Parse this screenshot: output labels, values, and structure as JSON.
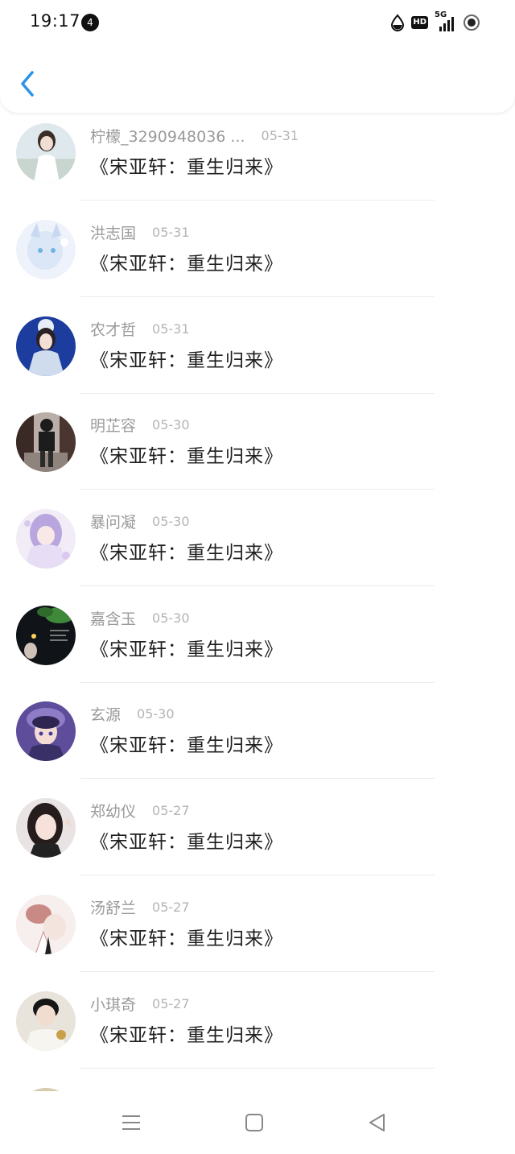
{
  "status_bar": {
    "time": "19:17",
    "notification_count": "4",
    "network": "5G",
    "hd": "HD"
  },
  "header": {
    "back_icon": "chevron-left-icon",
    "accent": "#2c93e8"
  },
  "comments": [
    {
      "name": "柠檬_3290948036 ...",
      "date": "05-31",
      "text": "《宋亚轩：重生归来》"
    },
    {
      "name": "洪志国",
      "date": "05-31",
      "text": "《宋亚轩：重生归来》"
    },
    {
      "name": "农才哲",
      "date": "05-31",
      "text": "《宋亚轩：重生归来》"
    },
    {
      "name": "明芷容",
      "date": "05-30",
      "text": "《宋亚轩：重生归来》"
    },
    {
      "name": "暴问凝",
      "date": "05-30",
      "text": "《宋亚轩：重生归来》"
    },
    {
      "name": "嘉含玉",
      "date": "05-30",
      "text": "《宋亚轩：重生归来》"
    },
    {
      "name": "玄源",
      "date": "05-30",
      "text": "《宋亚轩：重生归来》"
    },
    {
      "name": "郑幼仪",
      "date": "05-27",
      "text": "《宋亚轩：重生归来》"
    },
    {
      "name": "汤舒兰",
      "date": "05-27",
      "text": "《宋亚轩：重生归来》"
    },
    {
      "name": "小琪奇",
      "date": "05-27",
      "text": "《宋亚轩：重生归来》"
    }
  ],
  "nav_bar": {
    "icons": [
      "menu-icon",
      "home-square-icon",
      "back-triangle-icon"
    ]
  }
}
